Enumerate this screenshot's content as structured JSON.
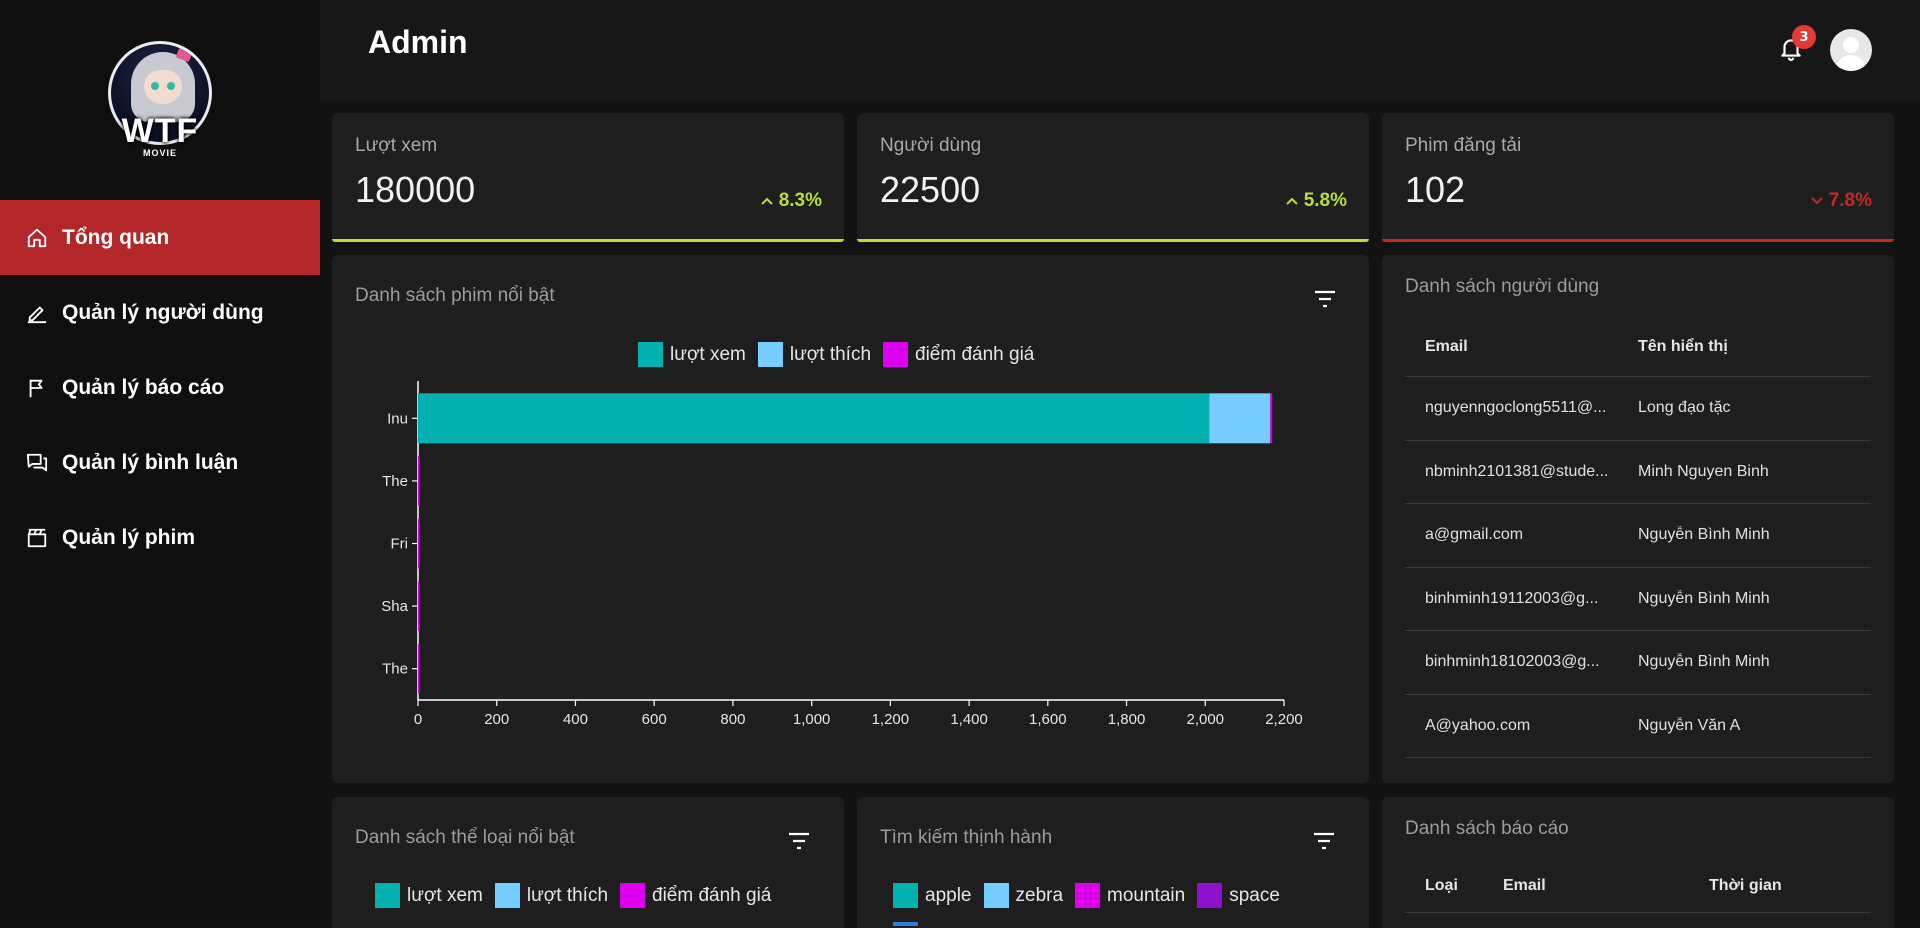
{
  "app": {
    "logo_text": "WTF",
    "logo_subtext": "MOVIE"
  },
  "sidebar": {
    "items": [
      {
        "label": "Tổng quan",
        "icon": "home-icon",
        "active": true
      },
      {
        "label": "Quản lý người dùng",
        "icon": "edit-icon",
        "active": false
      },
      {
        "label": "Quản lý báo cáo",
        "icon": "flag-icon",
        "active": false
      },
      {
        "label": "Quản lý bình luận",
        "icon": "chat-icon",
        "active": false
      },
      {
        "label": "Quản lý phim",
        "icon": "clapperboard-icon",
        "active": false
      }
    ]
  },
  "header": {
    "title": "Admin",
    "notification_count": "3"
  },
  "stats": [
    {
      "label": "Lượt xem",
      "value": "180000",
      "change": "8.3%",
      "direction": "up",
      "color": "#b8e034"
    },
    {
      "label": "Người dùng",
      "value": "22500",
      "change": "5.8%",
      "direction": "up",
      "color": "#b8e034"
    },
    {
      "label": "Phim đăng tải",
      "value": "102",
      "change": "7.8%",
      "direction": "down",
      "color": "#c62828"
    }
  ],
  "featured_movies": {
    "title": "Danh sách phim nổi bật",
    "legend": [
      "lượt xem",
      "lượt thích",
      "điểm đánh giá"
    ]
  },
  "users_list": {
    "title": "Danh sách người dùng",
    "columns": [
      "Email",
      "Tên hiển thị"
    ],
    "rows": [
      [
        "nguyenngoclong5511@...",
        "Long đạo tặc"
      ],
      [
        "nbminh2101381@stude...",
        "Minh Nguyen Binh"
      ],
      [
        "a@gmail.com",
        "Nguyễn Bình Minh"
      ],
      [
        "binhminh19112003@g...",
        "Nguyễn Bình Minh"
      ],
      [
        "binhminh18102003@g...",
        "Nguyễn Bình Minh"
      ],
      [
        "A@yahoo.com",
        "Nguyễn Văn A"
      ]
    ]
  },
  "genres": {
    "title": "Danh sách thể loại nổi bật",
    "legend": [
      "lượt xem",
      "lượt thích",
      "điểm đánh giá"
    ]
  },
  "trending_search": {
    "title": "Tìm kiếm thịnh hành",
    "legend": [
      "apple",
      "zebra",
      "mountain",
      "space"
    ]
  },
  "reports": {
    "title": "Danh sách báo cáo",
    "columns": [
      "Loại",
      "Email",
      "Thời gian"
    ]
  },
  "colors": {
    "views": "#03b0b0",
    "likes": "#76cdff",
    "rating": "#dd00ee",
    "space": "#9010d0",
    "active_nav": "#b3262a"
  },
  "chart_data": {
    "type": "bar",
    "orientation": "horizontal",
    "stacked": true,
    "categories": [
      "Inu",
      "The",
      "Fri",
      "Sha",
      "The"
    ],
    "series": [
      {
        "name": "lượt xem",
        "values": [
          2010,
          0,
          0,
          0,
          0
        ]
      },
      {
        "name": "lượt thích",
        "values": [
          155,
          0,
          0,
          0,
          0
        ]
      },
      {
        "name": "điểm đánh giá",
        "values": [
          5,
          2,
          2,
          3,
          2
        ]
      }
    ],
    "xlim": [
      0,
      2200
    ],
    "xticks": [
      "0",
      "200",
      "400",
      "600",
      "800",
      "1,000",
      "1,200",
      "1,400",
      "1,600",
      "1,800",
      "2,000",
      "2,200"
    ],
    "legend_position": "top"
  }
}
